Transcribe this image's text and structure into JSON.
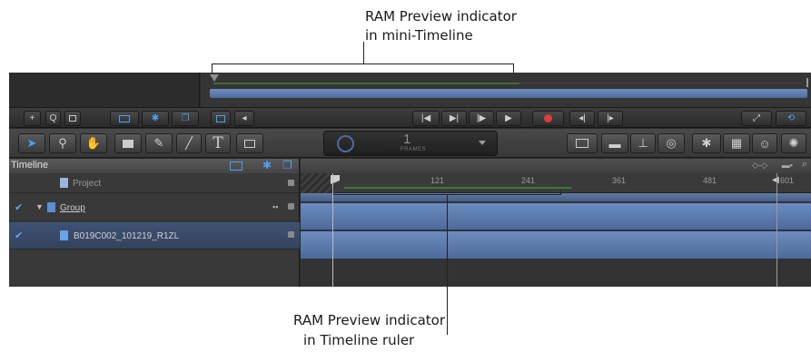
{
  "annotations": {
    "top_line1": "RAM Preview indicator",
    "top_line2": "in mini-Timeline",
    "bottom_line1": "RAM Preview indicator",
    "bottom_line2": "in Timeline ruler"
  },
  "transport": {
    "left_buttons": [
      "+",
      "Q"
    ],
    "play_icon": "play-icon",
    "record_icon": "record-icon"
  },
  "toolbar": {
    "frames_value": "1",
    "frames_label": "FRAMES",
    "text_tool": "T"
  },
  "timeline": {
    "title": "Timeline",
    "ruler_ticks": [
      "121",
      "241",
      "361",
      "481",
      "601"
    ],
    "layers": [
      {
        "name": "Project",
        "checked": false
      },
      {
        "name": "Group",
        "checked": true
      },
      {
        "name": "B019C002_101219_R1ZL",
        "checked": true
      }
    ]
  },
  "colors": {
    "ram_preview_green": "#3a7a32",
    "track_blue": "#5b79aa",
    "accent_blue": "#4aa0f2",
    "record_red": "#e03c3c"
  }
}
